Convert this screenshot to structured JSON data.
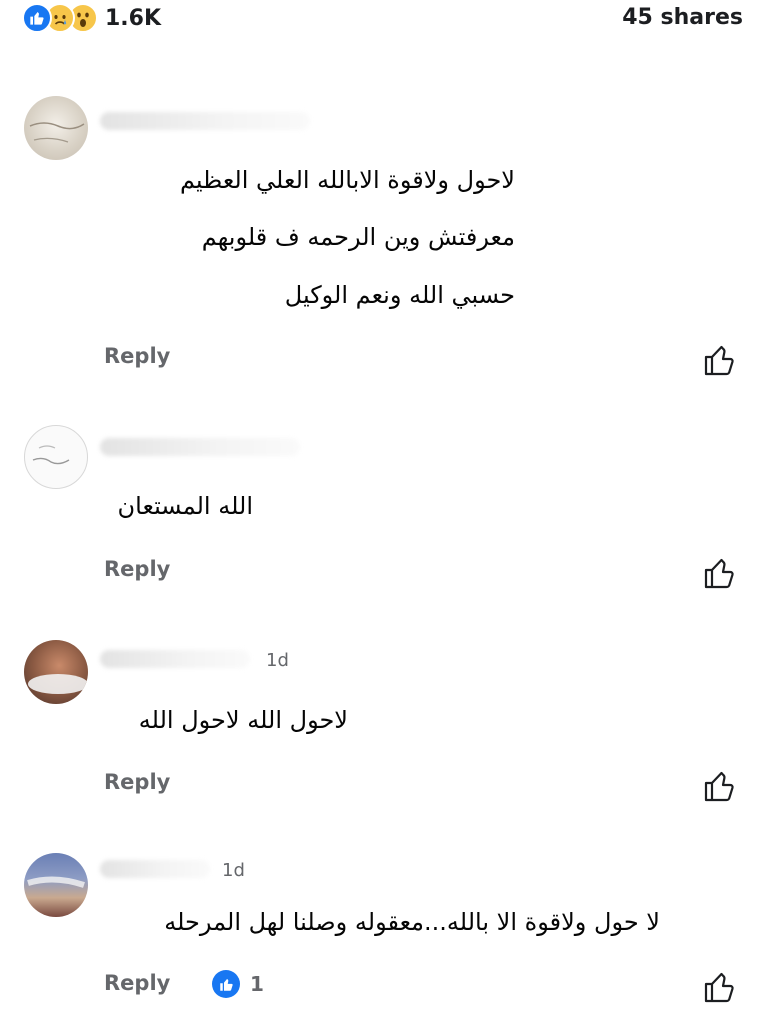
{
  "header": {
    "reaction_icons": [
      "like-icon",
      "sad-icon",
      "wow-icon"
    ],
    "reaction_count": "1.6K",
    "shares": "45 shares"
  },
  "comments": [
    {
      "lines": [
        "لاحول ولاقوة الابالله العلي العظيم",
        "معرفتش وين الرحمه ف قلوبهم",
        "حسبي الله ونعم الوكيل"
      ],
      "reply": "Reply"
    },
    {
      "lines": [
        "الله المستعان"
      ],
      "reply": "Reply"
    },
    {
      "time": "1d",
      "lines": [
        "لاحول الله لاحول الله"
      ],
      "reply": "Reply"
    },
    {
      "time": "1d",
      "lines": [
        "لا حول ولاقوة الا بالله...معقوله وصلنا لهل المرحله"
      ],
      "reply": "Reply",
      "like_count": "1"
    }
  ],
  "colors": {
    "accent": "#1877f2",
    "secondary_text": "#65676b",
    "primary_text": "#050505"
  }
}
